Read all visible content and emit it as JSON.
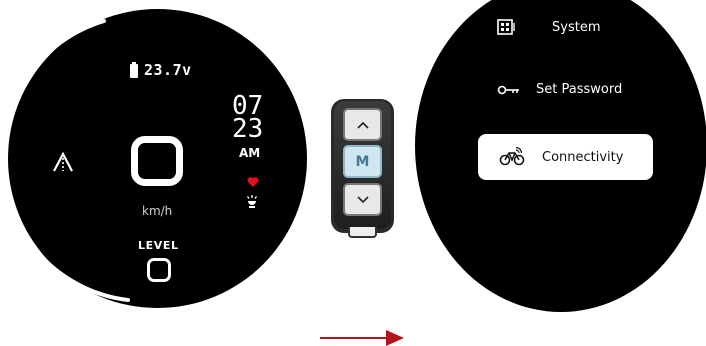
{
  "dashboard": {
    "battery_voltage": "23.7v",
    "speed_unit": "km/h",
    "time_hour": "07",
    "time_minute": "23",
    "time_period": "AM",
    "level_label": "LEVEL",
    "colors": {
      "background": "#000000",
      "text": "#ffffff",
      "heart": "#e0121f"
    }
  },
  "remote": {
    "up_icon": "chevron-up-icon",
    "mode_label": "M",
    "down_icon": "chevron-down-icon"
  },
  "transition": {
    "icon": "arrow-right-icon",
    "color": "#b1141b"
  },
  "menu": {
    "items": [
      {
        "label": "System",
        "icon": "system-icon",
        "selected": false
      },
      {
        "label": "Set Password",
        "icon": "key-icon",
        "selected": false
      },
      {
        "label": "Connectivity",
        "icon": "bike-wireless-icon",
        "selected": true
      }
    ]
  }
}
